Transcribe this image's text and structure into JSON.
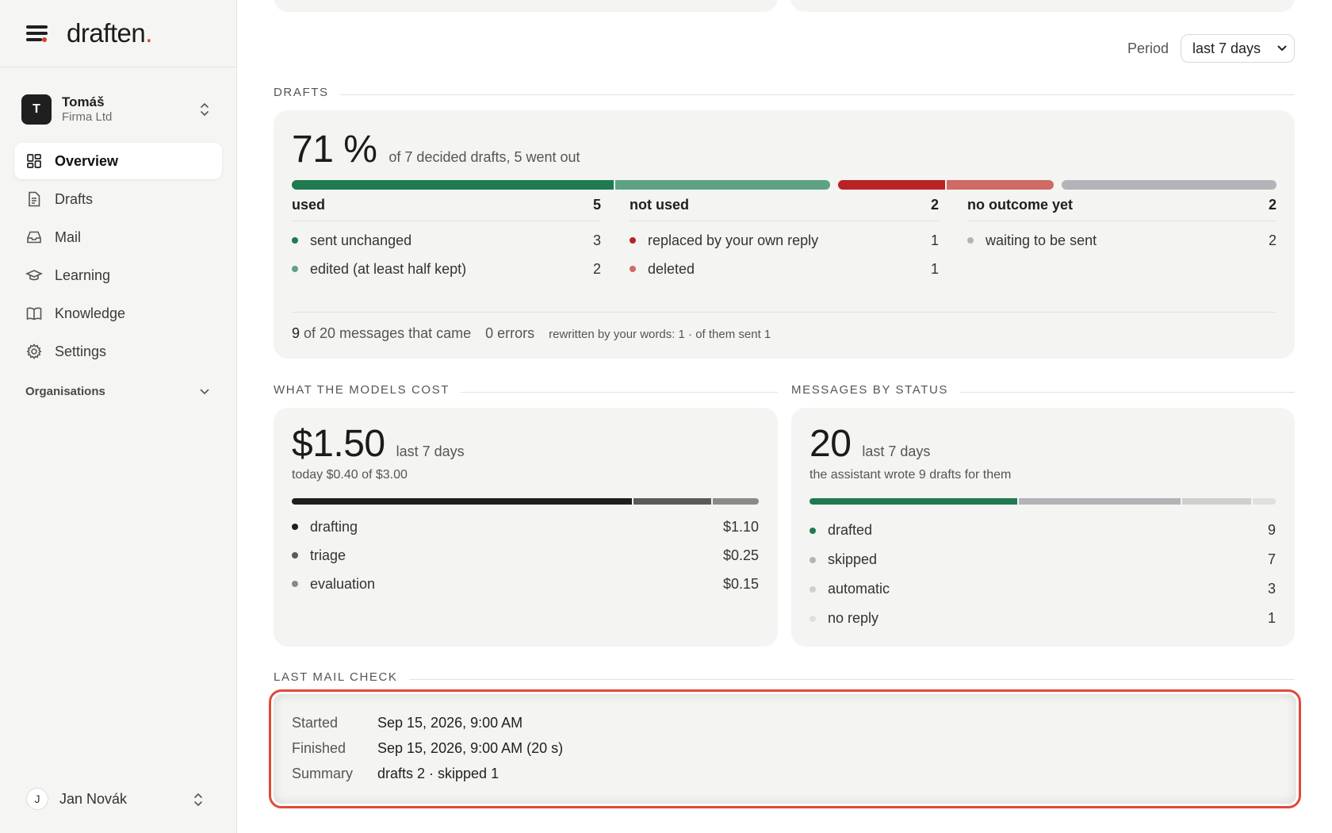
{
  "app": {
    "logo_text": "draften",
    "logo_dot": "."
  },
  "account": {
    "initial": "T",
    "name": "Tomáš",
    "org": "Firma Ltd"
  },
  "nav": {
    "items": [
      {
        "label": "Overview",
        "icon": "grid-icon",
        "active": true
      },
      {
        "label": "Drafts",
        "icon": "document-icon"
      },
      {
        "label": "Mail",
        "icon": "inbox-icon"
      },
      {
        "label": "Learning",
        "icon": "graduation-cap-icon"
      },
      {
        "label": "Knowledge",
        "icon": "book-icon"
      },
      {
        "label": "Settings",
        "icon": "gear-icon"
      }
    ],
    "organisations_label": "Organisations"
  },
  "user": {
    "initial": "J",
    "name": "Jan Novák"
  },
  "period": {
    "label": "Period",
    "value": "last 7 days"
  },
  "drafts": {
    "section_title": "DRAFTS",
    "big_number": "71 %",
    "subtitle": "of 7 decided drafts, 5 went out",
    "bar": {
      "used_sent_unchanged": 3,
      "used_edited": 2,
      "not_used_replaced": 1,
      "not_used_deleted": 1,
      "no_outcome": 2
    },
    "groups": [
      {
        "title": "used",
        "count": "5",
        "rows": [
          {
            "label": "sent unchanged",
            "value": "3",
            "color": "#1f7a4f"
          },
          {
            "label": "edited (at least half kept)",
            "value": "2",
            "color": "#5da383"
          }
        ]
      },
      {
        "title": "not used",
        "count": "2",
        "rows": [
          {
            "label": "replaced by your own reply",
            "value": "1",
            "color": "#b92323"
          },
          {
            "label": "deleted",
            "value": "1",
            "color": "#cf6a64"
          }
        ]
      },
      {
        "title": "no outcome yet",
        "count": "2",
        "rows": [
          {
            "label": "waiting to be sent",
            "value": "2",
            "color": "#b4b4b8"
          }
        ]
      }
    ],
    "footer": {
      "messages_num": "9",
      "messages_text": " of 20 messages that came",
      "errors": "0 errors",
      "rewritten": "rewritten by your words: 1 · of them sent 1"
    }
  },
  "costs": {
    "section_title": "WHAT THE MODELS COST",
    "big_number": "$1.50",
    "period": "last 7 days",
    "today": "today $0.40 of $3.00",
    "rows": [
      {
        "label": "drafting",
        "value": "$1.10",
        "amount": 1.1,
        "color": "#1f1f1f"
      },
      {
        "label": "triage",
        "value": "$0.25",
        "amount": 0.25,
        "color": "#5a5a5a"
      },
      {
        "label": "evaluation",
        "value": "$0.15",
        "amount": 0.15,
        "color": "#8a8a8a"
      }
    ]
  },
  "status": {
    "section_title": "MESSAGES BY STATUS",
    "big_number": "20",
    "period": "last 7 days",
    "subtitle": "the assistant wrote 9 drafts for them",
    "rows": [
      {
        "label": "drafted",
        "value": "9",
        "count": 9,
        "color": "#1f7a4f"
      },
      {
        "label": "skipped",
        "value": "7",
        "count": 7,
        "color": "#b4b4b8"
      },
      {
        "label": "automatic",
        "value": "3",
        "count": 3,
        "color": "#cfcfcf"
      },
      {
        "label": "no reply",
        "value": "1",
        "count": 1,
        "color": "#e0e0e0"
      }
    ]
  },
  "mail_check": {
    "section_title": "LAST MAIL CHECK",
    "rows": [
      {
        "key": "Started",
        "value": "Sep 15, 2026, 9:00 AM"
      },
      {
        "key": "Finished",
        "value": "Sep 15, 2026, 9:00 AM (20 s)"
      },
      {
        "key": "Summary",
        "value": "drafts 2 · skipped 1"
      }
    ]
  }
}
